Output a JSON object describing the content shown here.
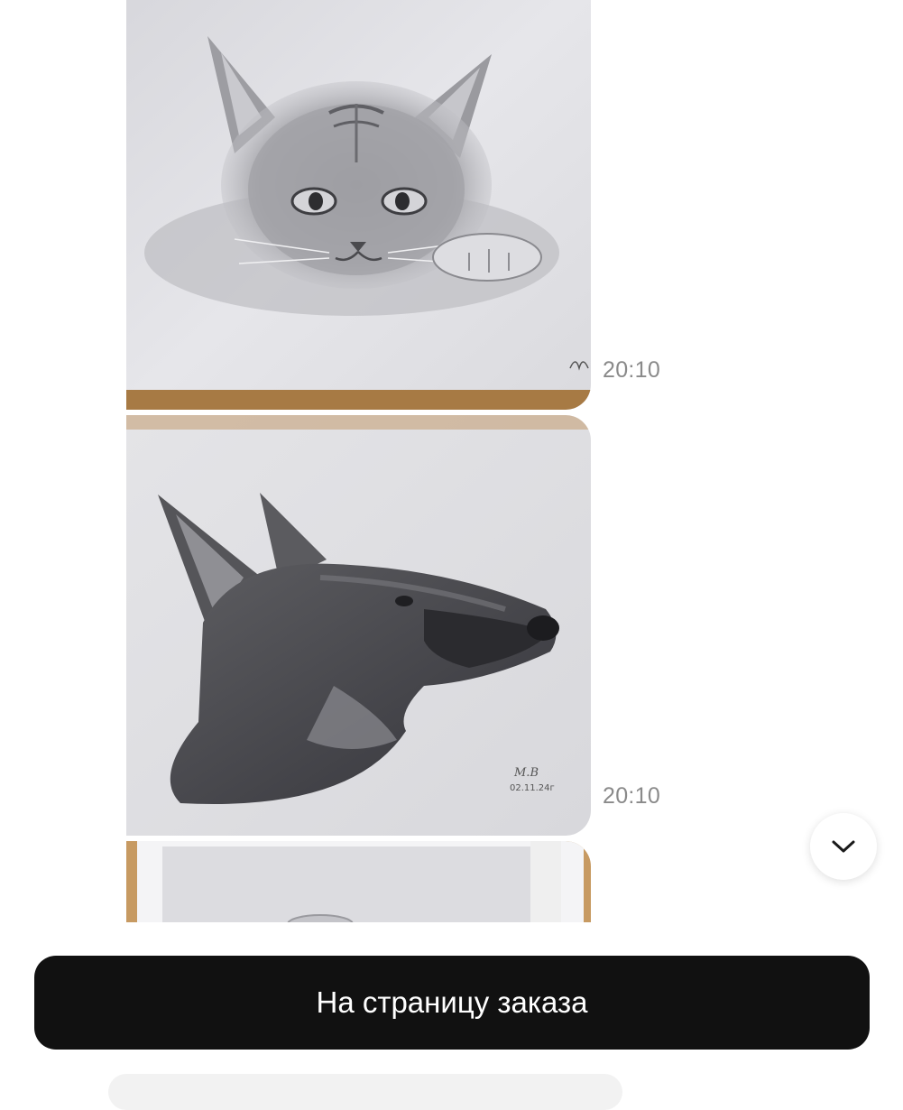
{
  "messages": [
    {
      "type": "image",
      "subject": "pencil drawing of a cat",
      "time": "20:10"
    },
    {
      "type": "image",
      "subject": "pencil drawing of a german shepherd",
      "time": "20:10"
    },
    {
      "type": "image",
      "subject": "framed pencil drawing",
      "time": ""
    }
  ],
  "scroll_button": {
    "icon": "chevron-down-icon"
  },
  "footer": {
    "order_button_label": "На страницу заказа"
  },
  "colors": {
    "button_bg": "#111111",
    "button_text": "#ffffff",
    "timestamp": "#8a8a8a",
    "paper": "#e9e9ec",
    "wood": "#a77a44"
  }
}
